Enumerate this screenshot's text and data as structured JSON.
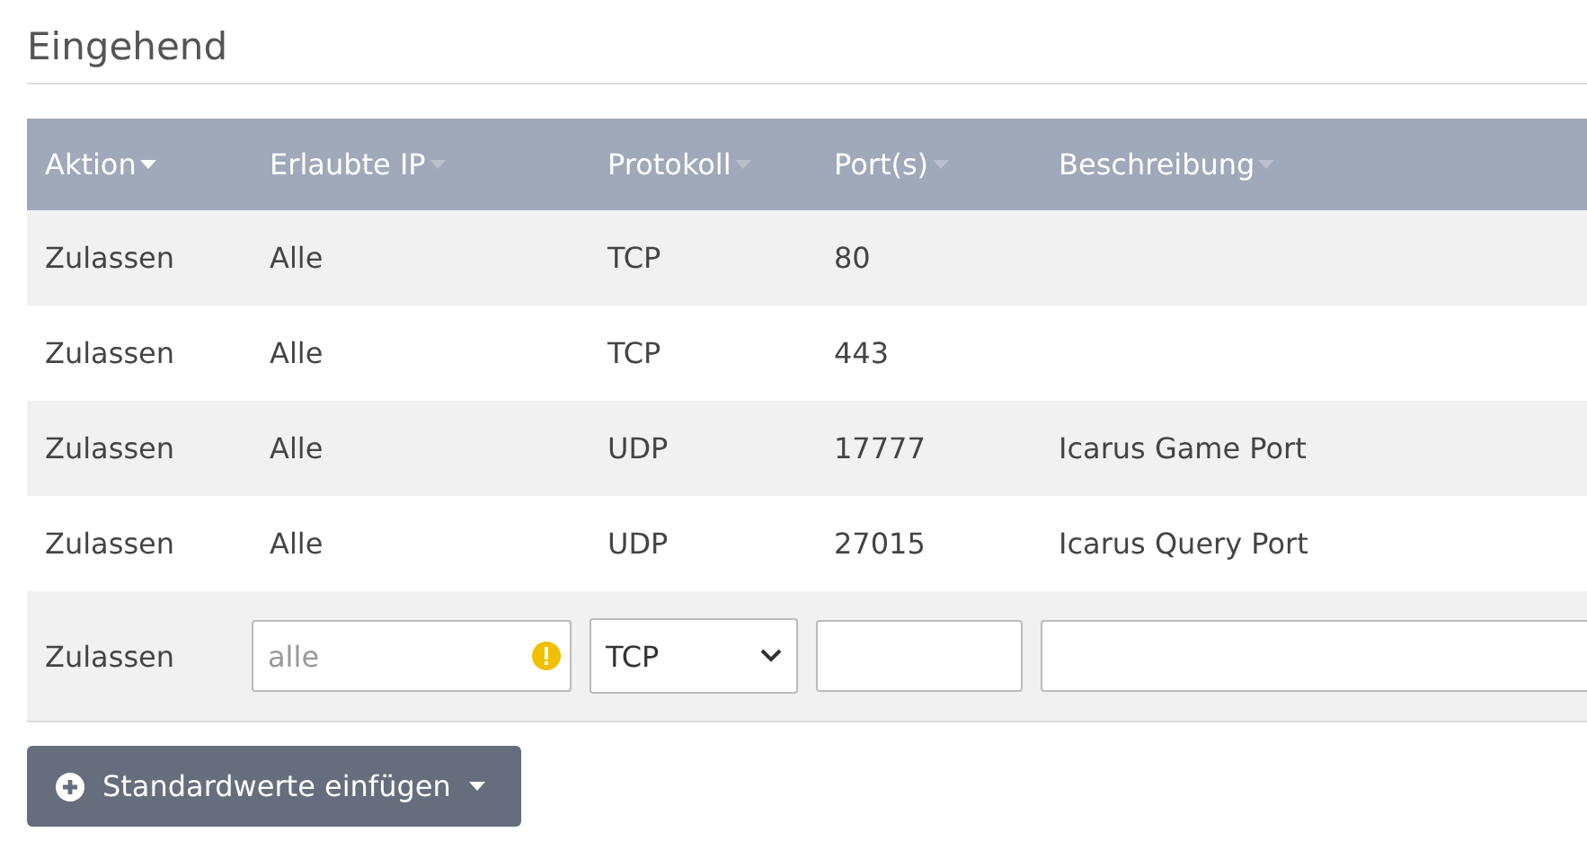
{
  "section_title": "Eingehend",
  "table": {
    "columns": [
      {
        "label": "Aktion",
        "sorted": true
      },
      {
        "label": "Erlaubte IP",
        "sorted": false
      },
      {
        "label": "Protokoll",
        "sorted": false
      },
      {
        "label": "Port(s)",
        "sorted": false
      },
      {
        "label": "Beschreibung",
        "sorted": false
      }
    ],
    "rows": [
      {
        "cells": [
          "Zulassen",
          "Alle",
          "TCP",
          "80",
          null
        ]
      },
      {
        "cells": [
          "Zulassen",
          "Alle",
          "TCP",
          "443",
          null
        ]
      },
      {
        "cells": [
          "Zulassen",
          "Alle",
          "UDP",
          "17777",
          "Icarus Game Port"
        ]
      },
      {
        "cells": [
          "Zulassen",
          "Alle",
          "UDP",
          "27015",
          "Icarus Query Port"
        ]
      }
    ],
    "new_row": {
      "action": "Zulassen",
      "ip": {
        "placeholder": "alle",
        "warning": true
      },
      "protocol": {
        "value": "TCP"
      }
    }
  },
  "add_button": {
    "label": "Standardwerte einfügen"
  }
}
